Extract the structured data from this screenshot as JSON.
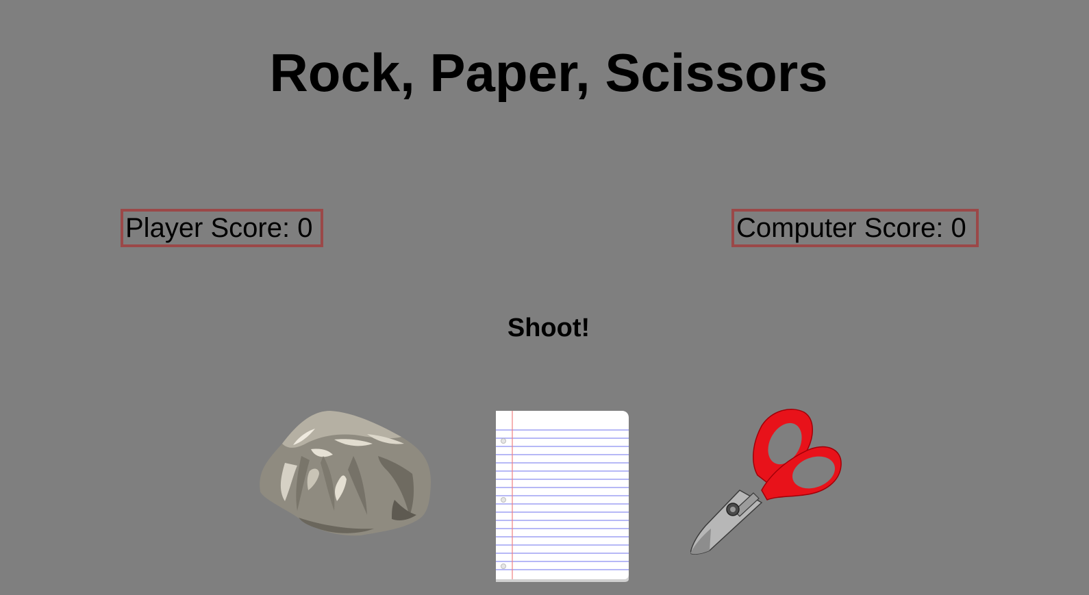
{
  "title": "Rock, Paper, Scissors",
  "scores": {
    "player_label": "Player Score: ",
    "player_value": "0",
    "computer_label": "Computer Score: ",
    "computer_value": "0"
  },
  "prompt": "Shoot!",
  "choices": [
    {
      "name": "rock",
      "icon": "rock-icon"
    },
    {
      "name": "paper",
      "icon": "paper-icon"
    },
    {
      "name": "scissors",
      "icon": "scissors-icon"
    }
  ],
  "colors": {
    "background": "#7f7f7f",
    "score_border": "#9b4848",
    "scissors_handle": "#e8121a"
  }
}
